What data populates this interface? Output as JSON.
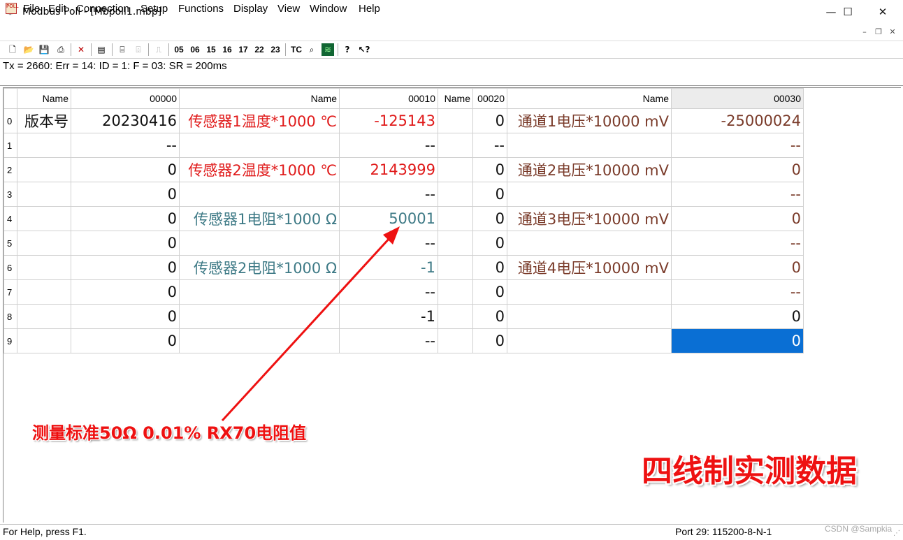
{
  "window": {
    "title": "Modbus Poll - [Mbpoll1.mbp]",
    "minimize": "—",
    "maximize": "☐",
    "close": "✕"
  },
  "menu": [
    "File",
    "Edit",
    "Connection",
    "Setup",
    "Functions",
    "Display",
    "View",
    "Window",
    "Help"
  ],
  "toolbar": {
    "function_codes": [
      "05",
      "06",
      "15",
      "16",
      "17",
      "22",
      "23"
    ],
    "tc_label": "TC"
  },
  "status_line": "Tx = 2660: Err = 14: ID = 1: F = 03: SR = 200ms",
  "grid": {
    "headers": [
      "Name",
      "00000",
      "Name",
      "00010",
      "Name",
      "00020",
      "Name",
      "00030"
    ],
    "rows": [
      {
        "idx": "0",
        "a_name": "版本号",
        "a_val": "20230416",
        "b_name": "传感器1温度*1000 ℃",
        "b_val": "-125143",
        "c_name": "",
        "c_val": "0",
        "d_name": "通道1电压*10000 mV",
        "d_val": "-25000024"
      },
      {
        "idx": "1",
        "a_name": "",
        "a_val": "--",
        "b_name": "",
        "b_val": "--",
        "c_name": "",
        "c_val": "--",
        "d_name": "",
        "d_val": "--"
      },
      {
        "idx": "2",
        "a_name": "",
        "a_val": "0",
        "b_name": "传感器2温度*1000 ℃",
        "b_val": "2143999",
        "c_name": "",
        "c_val": "0",
        "d_name": "通道2电压*10000 mV",
        "d_val": "0"
      },
      {
        "idx": "3",
        "a_name": "",
        "a_val": "0",
        "b_name": "",
        "b_val": "--",
        "c_name": "",
        "c_val": "0",
        "d_name": "",
        "d_val": "--"
      },
      {
        "idx": "4",
        "a_name": "",
        "a_val": "0",
        "b_name": "传感器1电阻*1000 Ω",
        "b_val": "50001",
        "c_name": "",
        "c_val": "0",
        "d_name": "通道3电压*10000 mV",
        "d_val": "0"
      },
      {
        "idx": "5",
        "a_name": "",
        "a_val": "0",
        "b_name": "",
        "b_val": "--",
        "c_name": "",
        "c_val": "0",
        "d_name": "",
        "d_val": "--"
      },
      {
        "idx": "6",
        "a_name": "",
        "a_val": "0",
        "b_name": "传感器2电阻*1000 Ω",
        "b_val": "-1",
        "c_name": "",
        "c_val": "0",
        "d_name": "通道4电压*10000 mV",
        "d_val": "0"
      },
      {
        "idx": "7",
        "a_name": "",
        "a_val": "0",
        "b_name": "",
        "b_val": "--",
        "c_name": "",
        "c_val": "0",
        "d_name": "",
        "d_val": "--"
      },
      {
        "idx": "8",
        "a_name": "",
        "a_val": "0",
        "b_name": "",
        "b_val": "-1",
        "c_name": "",
        "c_val": "0",
        "d_name": "",
        "d_val": "0"
      },
      {
        "idx": "9",
        "a_name": "",
        "a_val": "0",
        "b_name": "",
        "b_val": "--",
        "c_name": "",
        "c_val": "0",
        "d_name": "",
        "d_val": "0"
      }
    ]
  },
  "annotations": {
    "arrow_label": "测量标准50Ω 0.01% RX70电阻值",
    "corner_label": "四线制实测数据"
  },
  "statusbar": {
    "help": "For Help, press F1.",
    "port": "Port 29: 115200-8-N-1",
    "watermark": "CSDN @Sampkia"
  },
  "colors": {
    "temperature": "#e01a1a",
    "resistance": "#3e7a86",
    "voltage": "#7a3b2a",
    "selection": "#0a6fd4",
    "annotation": "#e11111"
  }
}
